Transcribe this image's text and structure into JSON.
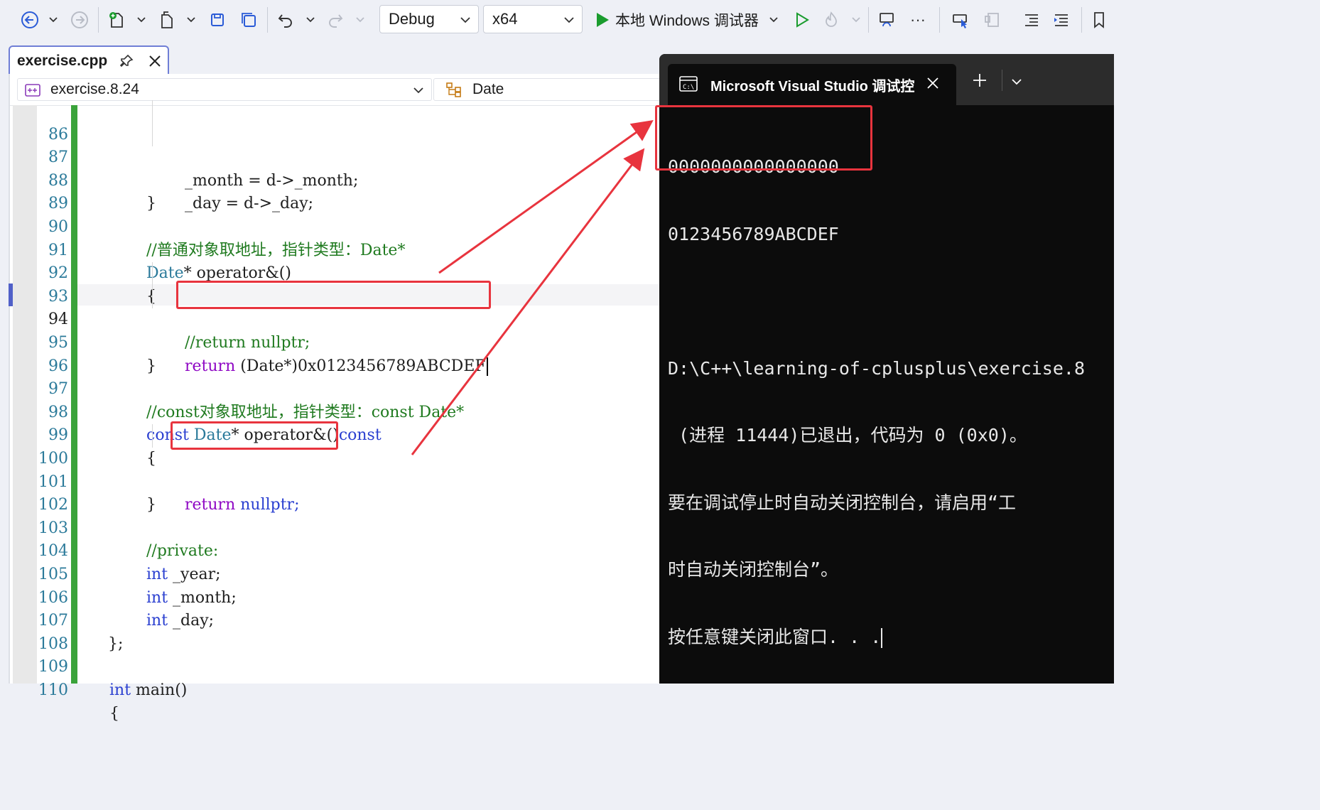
{
  "toolbar": {
    "config": "Debug",
    "platform": "x64",
    "run_label": "本地 Windows 调试器",
    "more": "···"
  },
  "editor_tab": {
    "title": "exercise.cpp"
  },
  "navbar": {
    "scope": "exercise.8.24",
    "member": "Date"
  },
  "code": {
    "lines": [
      {
        "n": "86",
        "text": "_month = d->_month;"
      },
      {
        "n": "87",
        "text": "_day = d->_day;"
      },
      {
        "n": "88",
        "text": "}"
      },
      {
        "n": "89",
        "text": ""
      },
      {
        "n": "90",
        "text": "//普通对象取地址，指针类型：Date*"
      },
      {
        "n": "91",
        "kw1": "Date",
        "rest": "* operator&()"
      },
      {
        "n": "92",
        "text": "{"
      },
      {
        "n": "93",
        "text": "//return nullptr;"
      },
      {
        "n": "94",
        "ret": "return",
        "rest": " (Date*)0x0123456789ABCDEF"
      },
      {
        "n": "95",
        "text": "}"
      },
      {
        "n": "96",
        "text": ""
      },
      {
        "n": "97",
        "text": "//const对象取地址，指针类型：const Date*"
      },
      {
        "n": "98",
        "kw1": "const",
        "mid": " Date",
        "rest": "* operator&()",
        "kw2": "const"
      },
      {
        "n": "99",
        "text": "{"
      },
      {
        "n": "100",
        "ret": "return",
        "rest": " nullptr;"
      },
      {
        "n": "101",
        "text": "}"
      },
      {
        "n": "102",
        "text": ""
      },
      {
        "n": "103",
        "text": "//private:"
      },
      {
        "n": "104",
        "kw1": "int",
        "rest": " _year;"
      },
      {
        "n": "105",
        "kw1": "int",
        "rest": " _month;"
      },
      {
        "n": "106",
        "kw1": "int",
        "rest": " _day;"
      },
      {
        "n": "107",
        "text": "};"
      },
      {
        "n": "108",
        "text": ""
      },
      {
        "n": "109",
        "kw1": "int",
        "rest": " main()"
      },
      {
        "n": "110",
        "text": "{"
      }
    ]
  },
  "console": {
    "title": "Microsoft Visual Studio 调试控",
    "output": [
      "0000000000000000",
      "0123456789ABCDEF",
      "",
      "D:\\C++\\learning-of-cplusplus\\exercise.8",
      " (进程 11444)已退出，代码为 0 (0x0)。",
      "要在调试停止时自动关闭控制台，请启用“工",
      "时自动关闭控制台”。",
      "按任意键关闭此窗口. . ."
    ]
  },
  "colors": {
    "accent": "#6f7ed6",
    "highlight_red": "#e8343e",
    "run_green": "#1a9c2e",
    "console_bg": "#0c0c0c"
  }
}
